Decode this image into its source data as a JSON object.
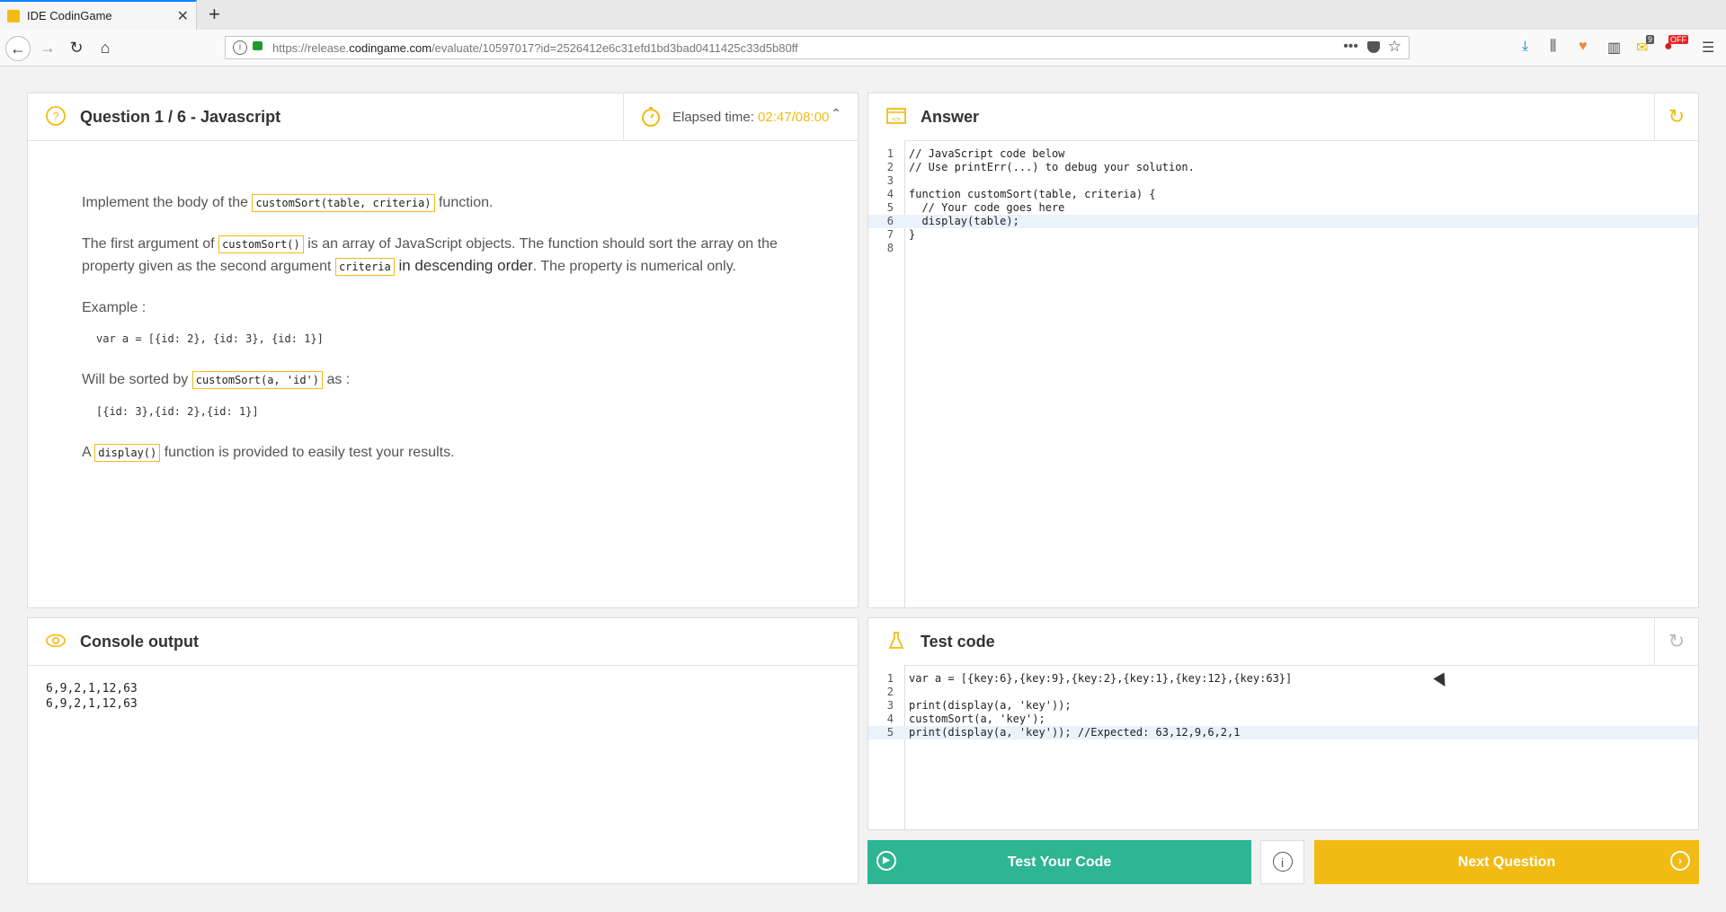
{
  "browser": {
    "tab_title": "IDE CodinGame",
    "tab_close": "✕",
    "new_tab": "+",
    "url_prefix": "https://release.",
    "url_domain": "codingame.com",
    "url_path": "/evaluate/10597017?id=2526412e6c31efd1bd3bad0411425c33d5b80ff",
    "ext_badge_1": "9",
    "ext_badge_2": "OFF"
  },
  "question": {
    "title": "Question 1 / 6 - Javascript",
    "elapsed_label": "Elapsed time: ",
    "elapsed_value": "02:47/08:00",
    "p1_a": "Implement the body of the ",
    "p1_code": "customSort(table, criteria)",
    "p1_b": " function.",
    "p2_a": "The first argument of ",
    "p2_code1": "customSort()",
    "p2_b": " is an array of JavaScript objects. The function should sort the array on the property given as the second argument ",
    "p2_code2": "criteria",
    "p2_c": " in descending order",
    "p2_d": ". The property is numerical only.",
    "example_label": "Example :",
    "example_code": "var a = [{id: 2}, {id: 3}, {id: 1}]",
    "sorted_a": "Will be sorted by ",
    "sorted_code": "customSort(a, 'id')",
    "sorted_b": " as :",
    "sorted_result": "[{id: 3},{id: 2},{id: 1}]",
    "p4_a": "A ",
    "p4_code": "display()",
    "p4_b": " function is provided to easily test your results."
  },
  "answer": {
    "title": "Answer",
    "lines": [
      {
        "n": "1",
        "t": "// JavaScript code below"
      },
      {
        "n": "2",
        "t": "// Use printErr(...) to debug your solution."
      },
      {
        "n": "3",
        "t": ""
      },
      {
        "n": "4",
        "t": "function customSort(table, criteria) {"
      },
      {
        "n": "5",
        "t": "  // Your code goes here"
      },
      {
        "n": "6",
        "t": "  display(table);"
      },
      {
        "n": "7",
        "t": "}"
      },
      {
        "n": "8",
        "t": ""
      }
    ]
  },
  "console": {
    "title": "Console output",
    "lines": [
      "6,9,2,1,12,63",
      "6,9,2,1,12,63"
    ]
  },
  "test": {
    "title": "Test code",
    "lines": [
      {
        "n": "1",
        "t": "var a = [{key:6},{key:9},{key:2},{key:1},{key:12},{key:63}]"
      },
      {
        "n": "2",
        "t": ""
      },
      {
        "n": "3",
        "t": "print(display(a, 'key'));"
      },
      {
        "n": "4",
        "t": "customSort(a, 'key');"
      },
      {
        "n": "5",
        "t": "print(display(a, 'key')); //Expected: 63,12,9,6,2,1"
      }
    ]
  },
  "buttons": {
    "test": "Test Your Code",
    "next": "Next Question",
    "info": "i"
  },
  "colors": {
    "accent": "#f2bb13",
    "test_button": "#2eb593"
  }
}
